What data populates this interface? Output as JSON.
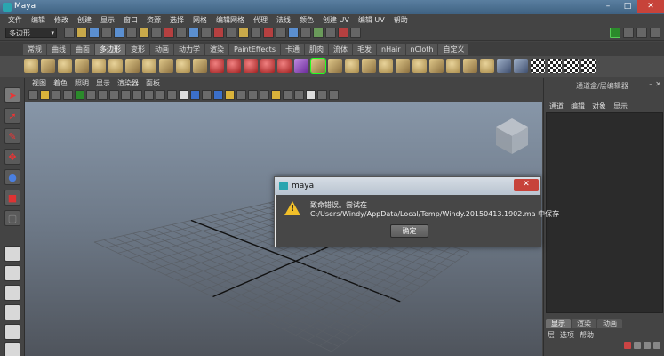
{
  "window": {
    "title": "Maya",
    "min_label": "–",
    "max_label": "□",
    "close_label": "✕"
  },
  "menubar": [
    "文件",
    "编辑",
    "修改",
    "创建",
    "显示",
    "窗口",
    "资源",
    "选择",
    "网格",
    "编辑网格",
    "代理",
    "法线",
    "颜色",
    "创建 UV",
    "编辑 UV",
    "帮助"
  ],
  "status": {
    "mode": "多边形",
    "mode_arrow": "▾"
  },
  "shelf_tabs": [
    "常规",
    "曲线",
    "曲面",
    "多边形",
    "变形",
    "动画",
    "动力学",
    "渲染",
    "PaintEffects",
    "卡通",
    "肌肉",
    "流体",
    "毛发",
    "nHair",
    "nCloth",
    "自定义"
  ],
  "shelf_active_index": 3,
  "viewport_menu": [
    "视图",
    "着色",
    "照明",
    "显示",
    "渲染器",
    "面板"
  ],
  "right_panel": {
    "title": "通道盒/层编辑器",
    "menu": [
      "通道",
      "编辑",
      "对象",
      "显示"
    ],
    "tabs": [
      "显示",
      "渲染",
      "动画"
    ],
    "sub_menu": [
      "层",
      "选项",
      "帮助"
    ]
  },
  "dialog": {
    "title": "maya",
    "close_label": "✕",
    "message_line1": "致命错误。尝试在",
    "message_line2": "C:/Users/Windy/AppData/Local/Temp/Windy.20150413.1902.ma 中保存",
    "ok_label": "确定",
    "warning_mark": "!"
  },
  "colors": {
    "accent": "#2b8a2b",
    "title_bar": "#4a6f92",
    "close": "#c7433a",
    "warning": "#f2c029"
  }
}
